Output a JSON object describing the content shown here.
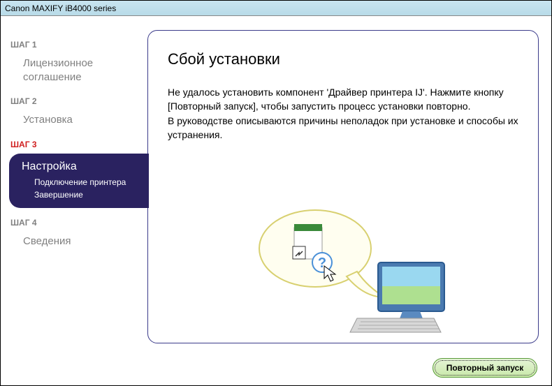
{
  "titlebar": "Canon MAXIFY iB4000 series",
  "sidebar": {
    "step1": {
      "label": "ШАГ 1",
      "item": "Лицензионное соглашение"
    },
    "step2": {
      "label": "ШАГ 2",
      "item": "Установка"
    },
    "step3": {
      "label": "ШАГ 3",
      "title": "Настройка",
      "sub1": "Подключение принтера",
      "sub2": "Завершение"
    },
    "step4": {
      "label": "ШАГ 4",
      "item": "Сведения"
    }
  },
  "content": {
    "title": "Сбой установки",
    "p1": "Не удалось установить компонент 'Драйвер принтера IJ'. Нажмите кнопку [Повторный запуск], чтобы запустить процесс установки повторно.",
    "p2": "В руководстве описываются причины неполадок при установке и способы их устранения."
  },
  "footer": {
    "retry": "Повторный запуск"
  }
}
